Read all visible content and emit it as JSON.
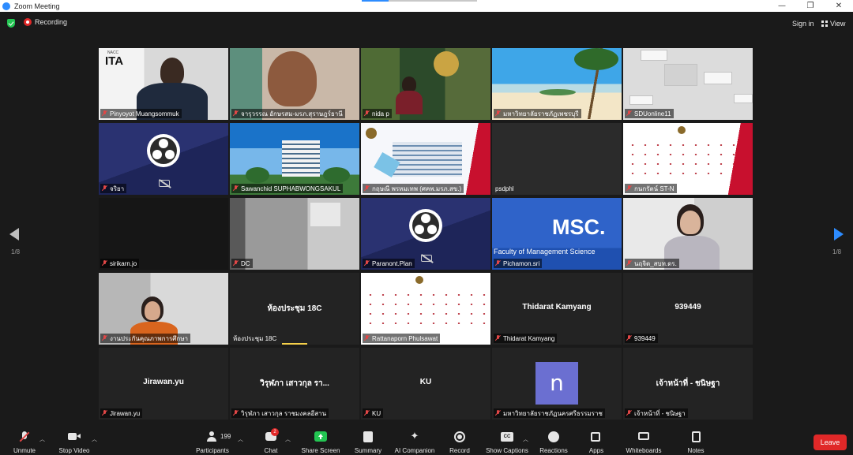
{
  "window": {
    "title": "Zoom Meeting",
    "minimize": "—",
    "restore": "❐",
    "close": "✕"
  },
  "topbar": {
    "recording": "Recording",
    "sign_in": "Sign in",
    "view": "View"
  },
  "tiles": [
    {
      "name": "Pinyoyot Muangsommuk",
      "overlay": "",
      "ita_small": "NACC",
      "ita_logo": "ITA"
    },
    {
      "name": "จารุวรรณ  อักษรสม-มรภ.สุราษฎร์ธานี",
      "overlay": ""
    },
    {
      "name": "nida p",
      "overlay": ""
    },
    {
      "name": "มหาวิทยาลัยราชภัฏเพชรบุรี",
      "overlay": ""
    },
    {
      "name": "SDUonline11",
      "overlay": ""
    },
    {
      "name": "จริยา",
      "overlay": ""
    },
    {
      "name": "Sawanchid SUPHABWONGSAKUL",
      "overlay": ""
    },
    {
      "name": "กฤษณี พรหมเทพ (ศคพ.มรภ.สข.)",
      "overlay": ""
    },
    {
      "name": "psdphl",
      "overlay": ""
    },
    {
      "name": "กนกรัตน์ ST-N",
      "overlay": ""
    },
    {
      "name": "sirikarn.jo",
      "overlay": ""
    },
    {
      "name": "DC",
      "overlay": ""
    },
    {
      "name": "Paranont.Plan",
      "overlay": ""
    },
    {
      "name": "Pichamon.sri",
      "overlay": "",
      "msc": "MSC.",
      "msc_sub": "Faculty of Management Science"
    },
    {
      "name": "นฤจิต_สบท.ดร.",
      "overlay": ""
    },
    {
      "name": "งานประกันคุณภาพการศึกษา",
      "overlay": ""
    },
    {
      "name": "ห้องประชุม 18C",
      "overlay": "ห้องประชุม 18C"
    },
    {
      "name": "Rattanaporn Phulsawat",
      "overlay": ""
    },
    {
      "name": "Thidarat Kamyang",
      "overlay": "Thidarat Kamyang"
    },
    {
      "name": "939449",
      "overlay": "939449"
    },
    {
      "name": "Jirawan.yu",
      "overlay": "Jirawan.yu"
    },
    {
      "name": "วิรุฬภา เสาวกุล ราชมงคลอีสาน",
      "overlay": "วิรุฬภา เสาวกุล รา..."
    },
    {
      "name": "KU",
      "overlay": "KU"
    },
    {
      "name": "มหาวิทยาลัยราชภัฏนครศรีธรรมราช",
      "overlay": "",
      "avatar": "n"
    },
    {
      "name": "เจ้าหน้าที่ - ชนิษฐา",
      "overlay": "เจ้าหน้าที่ - ชนิษฐา"
    }
  ],
  "pager": {
    "left": "1/8",
    "right": "1/8"
  },
  "toolbar": {
    "unmute": "Unmute",
    "stop_video": "Stop Video",
    "participants": "Participants",
    "participants_count": "199",
    "chat": "Chat",
    "chat_badge": "2",
    "share_screen": "Share Screen",
    "summary": "Summary",
    "ai_companion": "AI Companion",
    "record": "Record",
    "show_captions": "Show Captions",
    "reactions": "Reactions",
    "apps": "Apps",
    "whiteboards": "Whiteboards",
    "notes": "Notes",
    "leave": "Leave",
    "cc_text": "CC"
  },
  "colors": {
    "accent": "#2d8cff",
    "active_speaker": "#c9e265",
    "leave": "#e02828",
    "share": "#23c552"
  }
}
